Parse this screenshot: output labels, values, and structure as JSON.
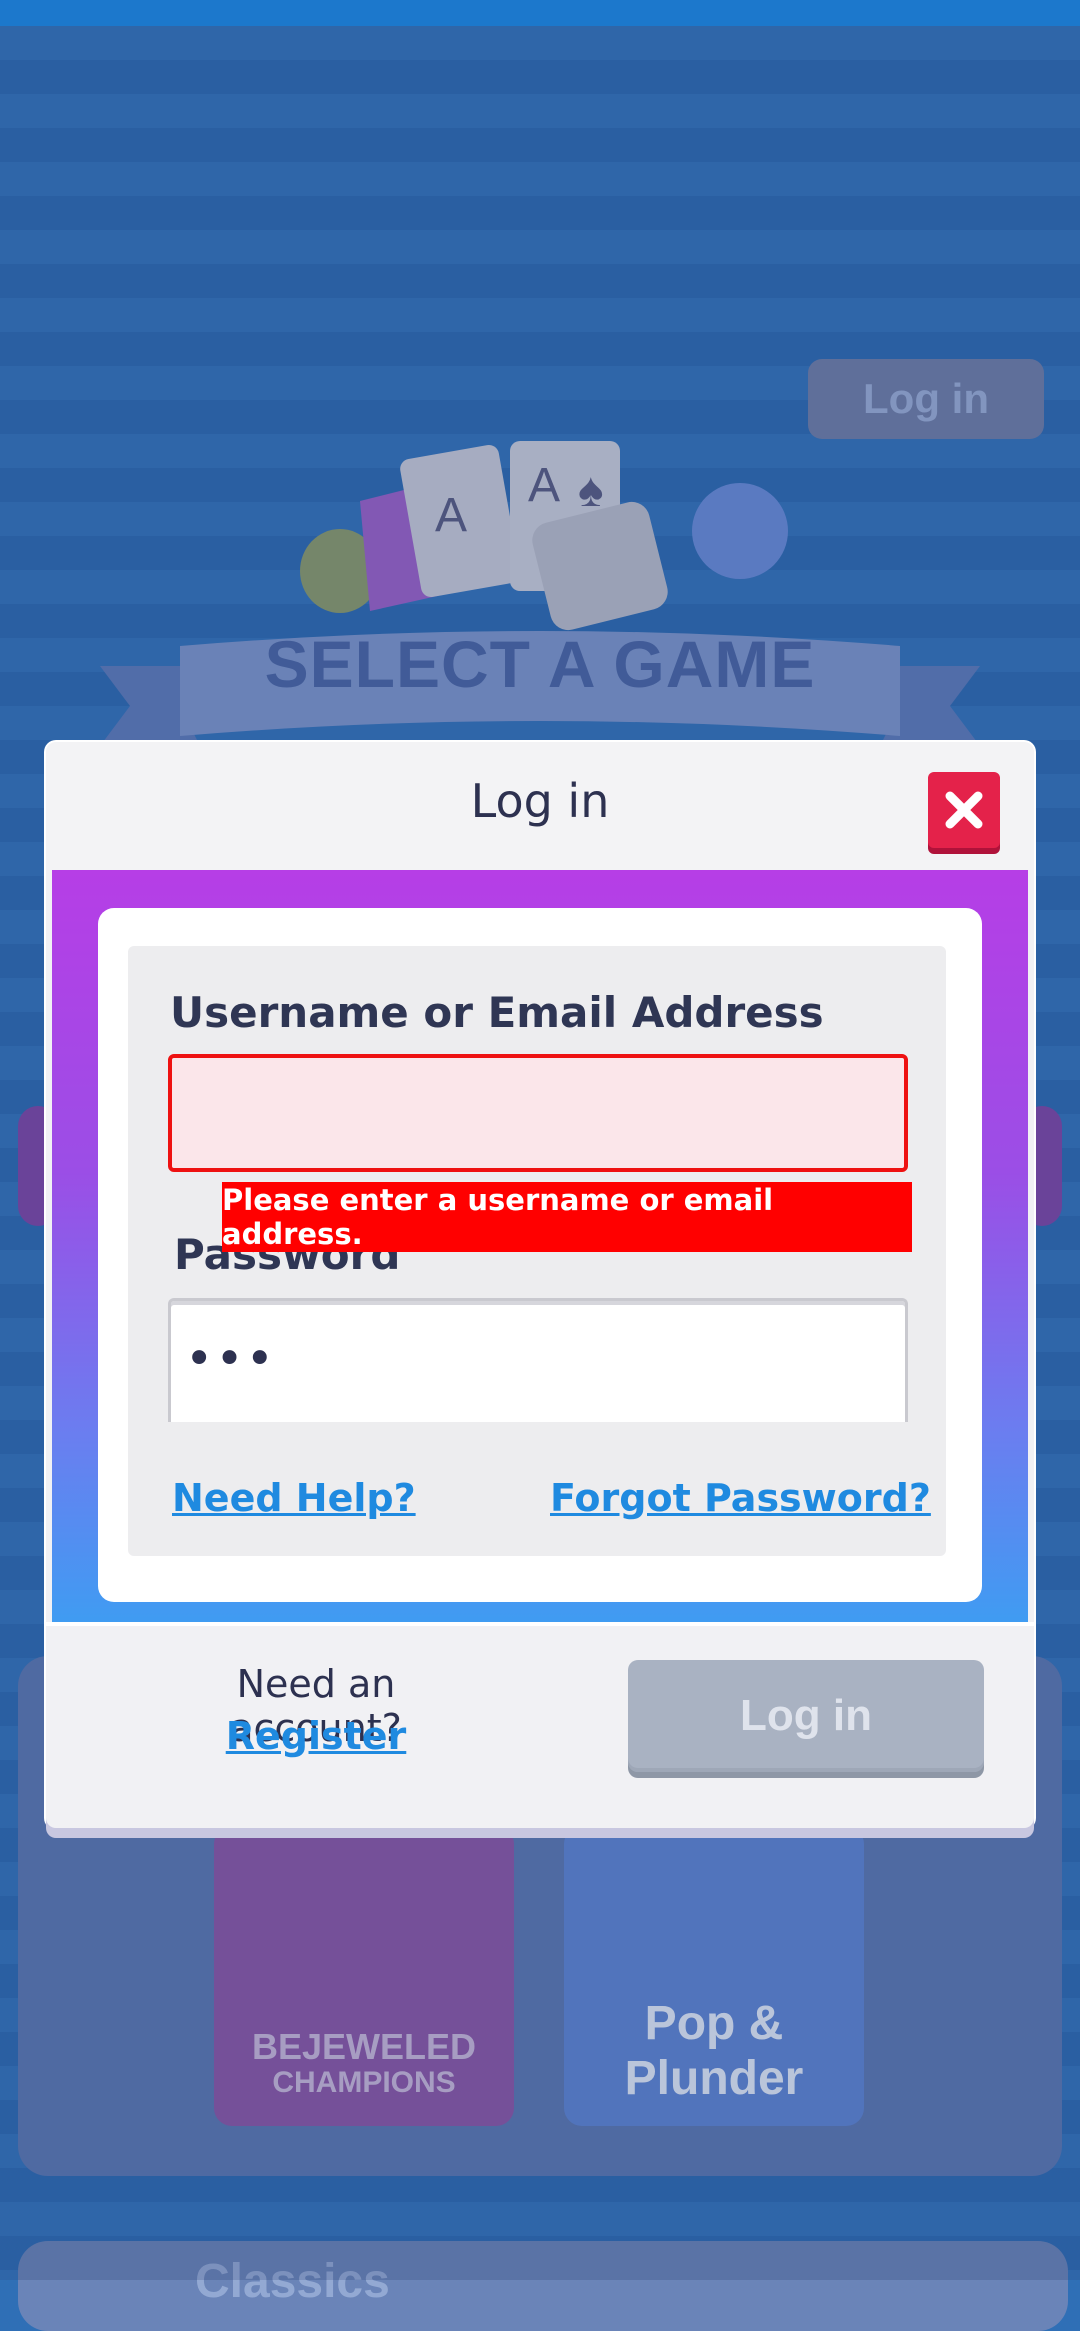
{
  "background": {
    "header_login_label": "Log in",
    "banner_title": "SELECT A GAME",
    "tiles": [
      {
        "label_line1": "BEJEWELED",
        "label_line2": "CHAMPIONS"
      },
      {
        "label_line1": "Pop &",
        "label_line2": "Plunder"
      }
    ],
    "classics_label": "Classics"
  },
  "dialog": {
    "title": "Log in",
    "close_icon": "close-icon",
    "username_label": "Username or Email Address",
    "username_value": "",
    "error_message": "Please enter a username or email address.",
    "password_label": "Password",
    "password_value": "•••",
    "need_help_link": "Need Help?",
    "forgot_password_link": "Forgot Password?",
    "need_account_text": "Need an account?",
    "register_link": "Register",
    "login_button": "Log in"
  },
  "colors": {
    "error": "#ff0000",
    "link": "#1f8ae0",
    "close_button": "#e4224a",
    "disabled_button": "#a9b2c2"
  }
}
